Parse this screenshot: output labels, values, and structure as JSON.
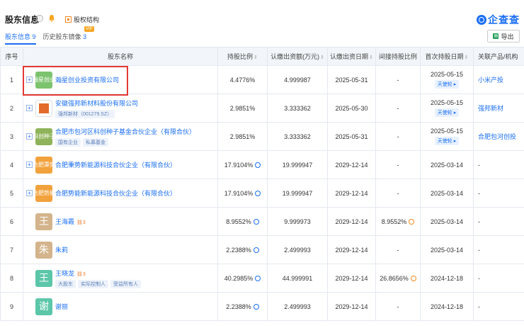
{
  "header": {
    "title": "股东信息",
    "info_icon": "ⓘ",
    "equity_link": "股权结构",
    "tabs": [
      {
        "label": "股东信息",
        "count": "9"
      },
      {
        "label": "历史股东镜像",
        "count": "3"
      }
    ],
    "vip_badge": "VIP",
    "logo_text": "企查查",
    "export_label": "导出"
  },
  "table": {
    "columns": [
      "序号",
      "股东名称",
      "持股比例",
      "认缴出资额(万元)",
      "认缴出资日期",
      "间接持股比例",
      "首次持股日期",
      "关联产品/机构"
    ],
    "rows": [
      {
        "idx": "1",
        "avatar": "瀚星创业",
        "name": "瀚星创业投资有限公司",
        "tags": [],
        "ratio": "4.4776%",
        "amount": "4.999987",
        "date": "2025-05-31",
        "indirect": "-",
        "first_date": "2025-05-15",
        "round": "天使轮",
        "product": "小米产投"
      },
      {
        "idx": "2",
        "avatar": "",
        "name": "安徽强邦新材料股份有限公司",
        "tags": [
          "强邦新材（001279.SZ）"
        ],
        "ratio": "2.9851%",
        "amount": "3.333362",
        "date": "2025-05-30",
        "indirect": "-",
        "first_date": "2025-05-15",
        "round": "天使轮",
        "product": "强邦新材"
      },
      {
        "idx": "3",
        "avatar": "科创种子",
        "name": "合肥市包河区科创种子基金合伙企业（有限合伙）",
        "tags": [
          "国有企业",
          "私募基金"
        ],
        "ratio": "2.9851%",
        "amount": "3.333362",
        "date": "2025-05-31",
        "indirect": "-",
        "first_date": "2025-05-15",
        "round": "天使轮",
        "product": "合肥包河创投"
      },
      {
        "idx": "4",
        "avatar": "合肥秉势",
        "name": "合肥秉势新能源科技合伙企业（有限合伙）",
        "tags": [],
        "ratio": "17.9104%",
        "amount": "19.999947",
        "date": "2029-12-14",
        "indirect": "-",
        "first_date": "2025-03-14",
        "round": "",
        "product": "-"
      },
      {
        "idx": "5",
        "avatar": "合肥势能",
        "name": "合肥势能新能源科技合伙企业（有限合伙）",
        "tags": [],
        "ratio": "17.9104%",
        "amount": "19.999947",
        "date": "2029-12-14",
        "indirect": "-",
        "first_date": "2025-03-14",
        "round": "",
        "product": "-"
      },
      {
        "idx": "6",
        "avatar": "王",
        "name": "王海霞",
        "rel": "3",
        "tags": [],
        "ratio": "8.9552%",
        "amount": "9.999973",
        "date": "2029-12-14",
        "indirect": "8.9552%",
        "first_date": "2025-03-14",
        "round": "",
        "product": "-"
      },
      {
        "idx": "7",
        "avatar": "朱",
        "name": "朱莉",
        "tags": [],
        "ratio": "2.2388%",
        "amount": "2.499993",
        "date": "2029-12-14",
        "indirect": "-",
        "first_date": "2025-03-14",
        "round": "",
        "product": "-"
      },
      {
        "idx": "8",
        "avatar": "王",
        "name": "王晓龙",
        "rel": "3",
        "tags": [
          "大股东",
          "实际控制人",
          "受益所有人"
        ],
        "ratio": "40.2985%",
        "amount": "44.999991",
        "date": "2029-12-14",
        "indirect": "26.8656%",
        "first_date": "2024-12-18",
        "round": "",
        "product": "-"
      },
      {
        "idx": "9",
        "avatar": "谢",
        "name": "谢丽",
        "tags": [],
        "ratio": "2.2388%",
        "amount": "2.499993",
        "date": "2029-12-14",
        "indirect": "-",
        "first_date": "2024-12-18",
        "round": "",
        "product": "-"
      }
    ]
  },
  "colors": {
    "accent": "#1a6ef2",
    "highlight": "#e53935"
  }
}
